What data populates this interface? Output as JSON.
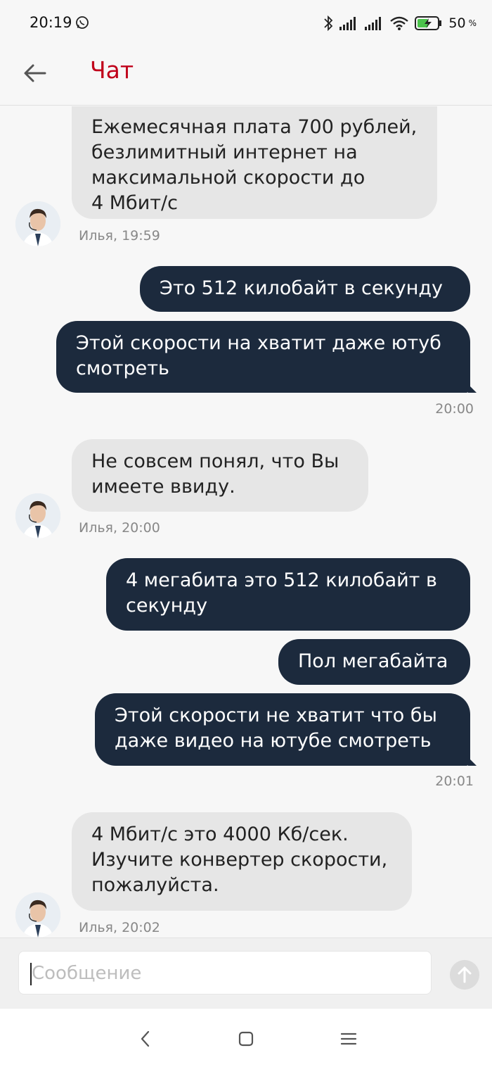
{
  "status_bar": {
    "time": "20:19",
    "battery_percent": "50",
    "battery_unit": "%",
    "icons": [
      "whatsapp-icon",
      "bluetooth-icon",
      "signal-icon",
      "signal-icon",
      "wifi-icon",
      "battery-charging-icon"
    ]
  },
  "header": {
    "title": "Чат",
    "back_icon": "arrow-left-icon",
    "title_color": "#c0001a"
  },
  "messages": [
    {
      "direction": "in",
      "lines": [
        "Ежемесячная плата 700 рублей,",
        "безлимитный интернет на",
        "максимальной скорости до",
        "4  Мбит/с"
      ],
      "meta": "Илья, 19:59"
    },
    {
      "direction": "out",
      "lines": [
        "Это 512 килобайт в секунду"
      ]
    },
    {
      "direction": "out",
      "lines": [
        "Этой скорости на хватит даже ютуб",
        "смотреть"
      ],
      "meta": "20:00"
    },
    {
      "direction": "in",
      "lines": [
        "Не совсем понял, что Вы",
        "имеете ввиду."
      ],
      "meta": "Илья, 20:00"
    },
    {
      "direction": "out",
      "lines": [
        "4 мегабита это 512 килобайт в",
        "секунду"
      ]
    },
    {
      "direction": "out",
      "lines": [
        "Пол мегабайта"
      ]
    },
    {
      "direction": "out",
      "lines": [
        "Этой скорости не хватит что бы",
        "даже видео на ютубе смотреть"
      ],
      "meta": "20:01"
    },
    {
      "direction": "in",
      "lines": [
        "4 Мбит/с это 4000 Кб/сек.",
        "Изучите конвертер скорости,",
        "пожалуйста."
      ],
      "meta": "Илья, 20:02"
    }
  ],
  "composer": {
    "placeholder": "Сообщение",
    "value": "",
    "send_icon": "arrow-up-icon"
  },
  "nav_bar": {
    "icons": [
      "back-triangle-icon",
      "home-square-icon",
      "recents-menu-icon"
    ]
  },
  "colors": {
    "incoming_bubble": "#e6e6e6",
    "outgoing_bubble": "#1c2a3d",
    "background": "#f7f7f7"
  }
}
